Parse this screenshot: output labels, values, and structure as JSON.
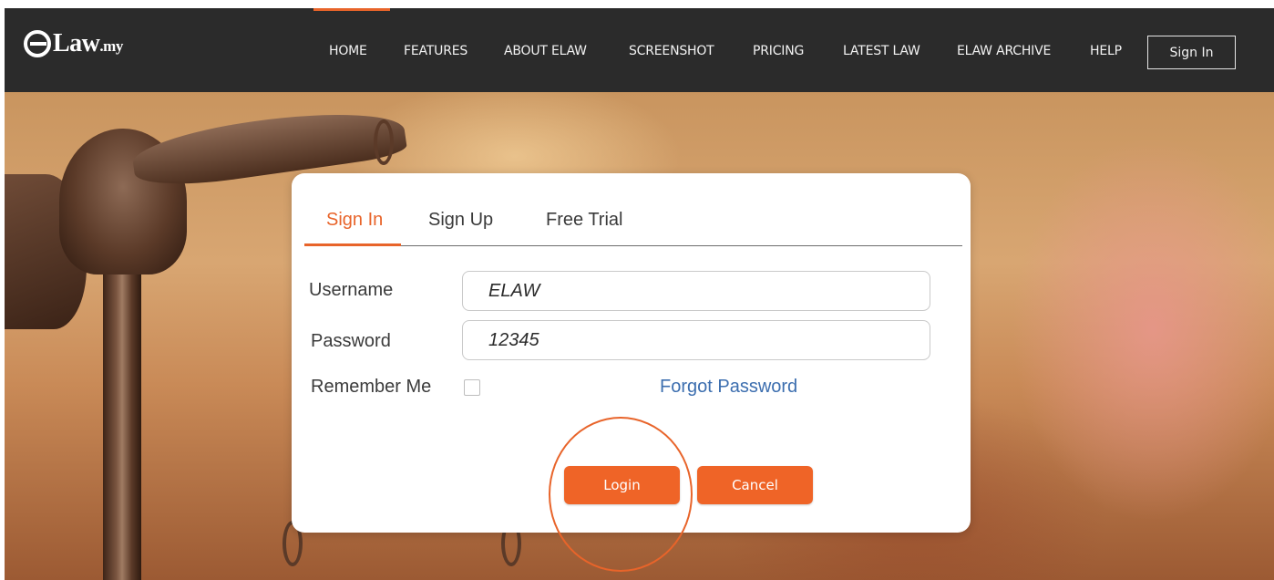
{
  "brand": {
    "logo_main": "Law",
    "logo_suffix": ".my"
  },
  "nav": {
    "items": [
      {
        "label": "HOME"
      },
      {
        "label": "FEATURES"
      },
      {
        "label": "ABOUT ELAW"
      },
      {
        "label": "SCREENSHOT"
      },
      {
        "label": "PRICING"
      },
      {
        "label": "LATEST LAW"
      },
      {
        "label": "ELAW ARCHIVE"
      },
      {
        "label": "HELP"
      }
    ],
    "active_item": "HOME",
    "signin_label": "Sign In"
  },
  "login": {
    "tabs": [
      {
        "label": "Sign In"
      },
      {
        "label": "Sign Up"
      },
      {
        "label": "Free Trial"
      }
    ],
    "active_tab": "Sign In",
    "username_label": "Username",
    "username_value": "ELAW",
    "password_label": "Password",
    "password_value": "12345",
    "remember_label": "Remember Me",
    "remember_checked": false,
    "forgot_label": "Forgot Password",
    "login_label": "Login",
    "cancel_label": "Cancel"
  },
  "colors": {
    "accent": "#ef6427",
    "navbar": "#2b2b2b",
    "link": "#3c6eaf"
  }
}
